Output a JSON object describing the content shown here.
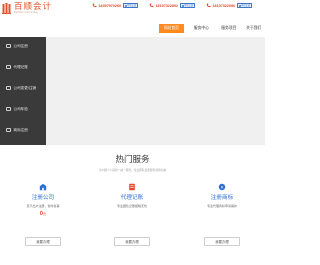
{
  "header": {
    "logo_text": "百顺会计",
    "logo_subtext": "Bai Shun Accounting",
    "phones": [
      {
        "number": "18397970260",
        "qq_label": "QQ交谈"
      },
      {
        "number": "18197322802",
        "qq_label": "QQ交谈"
      },
      {
        "number": "18197322096",
        "qq_label": "QQ交谈"
      }
    ]
  },
  "nav": {
    "items": [
      "网站首页",
      "服务中心",
      "服务项目",
      "关于我们"
    ],
    "active_index": 0
  },
  "sidebar": {
    "items": [
      {
        "label": "公司注册",
        "icon": "building-icon"
      },
      {
        "label": "代理记账",
        "icon": "ledger-icon"
      },
      {
        "label": "公司变更/注销",
        "icon": "document-icon"
      },
      {
        "label": "公司年检",
        "icon": "calendar-icon"
      },
      {
        "label": "商标注册",
        "icon": "trademark-icon"
      }
    ]
  },
  "services": {
    "title": "热门服务",
    "subtitle": "为小微个人提供一站一服务，专业团队优质服务值得信赖",
    "cards": [
      {
        "name": "注册公司",
        "desc": "足不出户注册，省时省事",
        "price": "0",
        "price_unit": "元",
        "button": "我要办理"
      },
      {
        "name": "代理记账",
        "desc": "专业团队记账报税无忧",
        "price": "",
        "price_unit": "",
        "button": "我要办理"
      },
      {
        "name": "注册商标",
        "desc": "专业代理商标申请保护",
        "price": "",
        "price_unit": "",
        "button": "我要办理"
      }
    ]
  },
  "colors": {
    "accent": "#ff8a1e",
    "brand": "#e2572a",
    "link_blue": "#2c6fd3",
    "sidebar_bg": "#3a3a3a"
  }
}
